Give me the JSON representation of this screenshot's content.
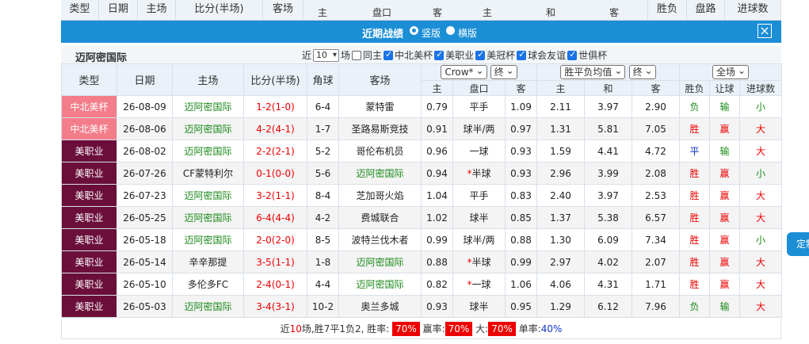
{
  "top_strip": {
    "cols": [
      "类型",
      "日期",
      "主场",
      "比分(半场)",
      "客场"
    ],
    "sub": [
      "主",
      "盘口",
      "客",
      "主",
      "和",
      "客"
    ],
    "right": [
      "胜负",
      "盘路",
      "进球数"
    ]
  },
  "title_bar": {
    "title": "近期战绩",
    "option1": "竖版",
    "option2": "横版",
    "close": "×"
  },
  "filter": {
    "team": "迈阿密国际",
    "near": "近",
    "count": "10",
    "unit": "场",
    "same_home": "同主",
    "leagues": [
      "中北美杯",
      "美职业",
      "美冠杯",
      "球会友谊",
      "世俱杯"
    ]
  },
  "table": {
    "headers": {
      "type": "类型",
      "date": "日期",
      "home": "主场",
      "score": "比分(半场)",
      "corner": "角球",
      "away": "客场",
      "company": "Crow*",
      "odds_kind": "终",
      "euro_label": "胜平负均值",
      "euro_kind": "终",
      "scope": "全场",
      "result": "胜负",
      "handicap_result": "让球",
      "goals": "进球数",
      "sub_home": "主",
      "sub_line": "盘口",
      "sub_away": "客",
      "sub_euro_home": "主",
      "sub_euro_draw": "和",
      "sub_euro_away": "客"
    },
    "rows": [
      {
        "type": "中北美杯",
        "cup": true,
        "date": "26-08-09",
        "home": "迈阿密国际",
        "home_hl": true,
        "score": "1-2(1-0)",
        "corner": "6-4",
        "away": "蒙特雷",
        "away_hl": false,
        "h": "0.79",
        "line": "平手",
        "star": "",
        "a": "1.09",
        "e1": "2.11",
        "e2": "3.97",
        "e3": "2.90",
        "res": "负",
        "hres": "输",
        "gres": "小"
      },
      {
        "type": "中北美杯",
        "cup": true,
        "date": "26-08-06",
        "home": "迈阿密国际",
        "home_hl": true,
        "score": "4-2(4-1)",
        "corner": "1-7",
        "away": "圣路易斯竞技",
        "away_hl": false,
        "h": "0.91",
        "line": "球半/两",
        "star": "",
        "a": "0.97",
        "e1": "1.31",
        "e2": "5.81",
        "e3": "7.05",
        "res": "胜",
        "hres": "赢",
        "gres": "大"
      },
      {
        "type": "美职业",
        "cup": false,
        "date": "26-08-02",
        "home": "迈阿密国际",
        "home_hl": true,
        "score": "2-2(2-1)",
        "corner": "5-2",
        "away": "哥伦布机员",
        "away_hl": false,
        "h": "0.96",
        "line": "一球",
        "star": "",
        "a": "0.93",
        "e1": "1.59",
        "e2": "4.41",
        "e3": "4.72",
        "res": "平",
        "hres": "输",
        "gres": "大"
      },
      {
        "type": "美职业",
        "cup": false,
        "date": "26-07-26",
        "home": "CF蒙特利尔",
        "home_hl": false,
        "score": "0-1(0-0)",
        "corner": "5-6",
        "away": "迈阿密国际",
        "away_hl": true,
        "h": "0.94",
        "line": "半球",
        "star": "*",
        "a": "0.93",
        "e1": "2.96",
        "e2": "3.99",
        "e3": "2.08",
        "res": "胜",
        "hres": "赢",
        "gres": "小"
      },
      {
        "type": "美职业",
        "cup": false,
        "date": "26-07-23",
        "home": "迈阿密国际",
        "home_hl": true,
        "score": "3-2(1-1)",
        "corner": "8-4",
        "away": "芝加哥火焰",
        "away_hl": false,
        "h": "1.04",
        "line": "平手",
        "star": "",
        "a": "0.83",
        "e1": "2.40",
        "e2": "3.97",
        "e3": "2.53",
        "res": "胜",
        "hres": "赢",
        "gres": "大"
      },
      {
        "type": "美职业",
        "cup": false,
        "date": "26-05-25",
        "home": "迈阿密国际",
        "home_hl": true,
        "score": "6-4(4-4)",
        "corner": "4-2",
        "away": "费城联合",
        "away_hl": false,
        "h": "1.02",
        "line": "球半",
        "star": "",
        "a": "0.85",
        "e1": "1.37",
        "e2": "5.38",
        "e3": "6.57",
        "res": "胜",
        "hres": "赢",
        "gres": "大"
      },
      {
        "type": "美职业",
        "cup": false,
        "date": "26-05-18",
        "home": "迈阿密国际",
        "home_hl": true,
        "score": "2-0(2-0)",
        "corner": "8-5",
        "away": "波特兰伐木者",
        "away_hl": false,
        "h": "0.99",
        "line": "球半/两",
        "star": "",
        "a": "0.88",
        "e1": "1.30",
        "e2": "6.09",
        "e3": "7.34",
        "res": "胜",
        "hres": "赢",
        "gres": "小"
      },
      {
        "type": "美职业",
        "cup": false,
        "date": "26-05-14",
        "home": "辛辛那提",
        "home_hl": false,
        "score": "3-5(1-1)",
        "corner": "1-8",
        "away": "迈阿密国际",
        "away_hl": true,
        "h": "0.88",
        "line": "半球",
        "star": "*",
        "a": "0.99",
        "e1": "2.97",
        "e2": "4.02",
        "e3": "2.07",
        "res": "胜",
        "hres": "赢",
        "gres": "大"
      },
      {
        "type": "美职业",
        "cup": false,
        "date": "26-05-10",
        "home": "多伦多FC",
        "home_hl": false,
        "score": "2-4(0-1)",
        "corner": "4-4",
        "away": "迈阿密国际",
        "away_hl": true,
        "h": "0.82",
        "line": "一球",
        "star": "*",
        "a": "1.06",
        "e1": "4.06",
        "e2": "4.31",
        "e3": "1.71",
        "res": "胜",
        "hres": "赢",
        "gres": "大"
      },
      {
        "type": "美职业",
        "cup": false,
        "date": "26-05-03",
        "home": "迈阿密国际",
        "home_hl": true,
        "score": "3-4(3-1)",
        "corner": "10-2",
        "away": "奥兰多城",
        "away_hl": false,
        "h": "0.93",
        "line": "球半",
        "star": "",
        "a": "0.95",
        "e1": "1.29",
        "e2": "6.12",
        "e3": "7.96",
        "res": "负",
        "hres": "输",
        "gres": "大"
      }
    ]
  },
  "summary": {
    "prefix": "近",
    "games": "10",
    "mid": "场,胜7平1负2, 胜率:",
    "win_rate": "70%",
    "hc_label": "赢率:",
    "hc_rate": "70%",
    "big_label": "大:",
    "big_rate": "70%",
    "odd_label": "单率:",
    "odd_rate": "40%"
  },
  "side_tab": "定制",
  "colors": {
    "accent": "#1b8ed6",
    "cup": "#f47d8a",
    "league": "#6b0f3a",
    "red": "#e00000",
    "green": "#1b8a1b"
  }
}
